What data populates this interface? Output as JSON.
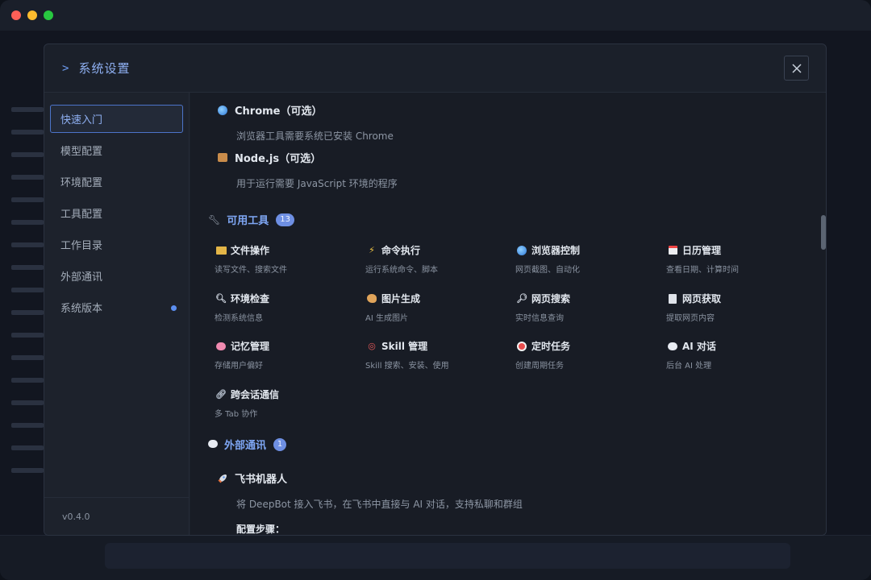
{
  "modal": {
    "title": "系统设置",
    "header_chevron": ">"
  },
  "sidebar": {
    "items": [
      {
        "label": "快速入门"
      },
      {
        "label": "模型配置"
      },
      {
        "label": "环境配置"
      },
      {
        "label": "工具配置"
      },
      {
        "label": "工作目录"
      },
      {
        "label": "外部通讯"
      },
      {
        "label": "系统版本"
      }
    ],
    "version": "v0.4.0"
  },
  "dependencies": [
    {
      "title": "Chrome（可选）",
      "desc": "浏览器工具需要系统已安装 Chrome",
      "icon": "globe-icon"
    },
    {
      "title": "Node.js（可选）",
      "desc": "用于运行需要 JavaScript 环境的程序",
      "icon": "package-icon"
    }
  ],
  "tools_section": {
    "title": "可用工具",
    "count": "13",
    "icon": "wrench-icon",
    "tools": [
      {
        "name": "文件操作",
        "desc": "读写文件、搜索文件",
        "icon": "folder-icon"
      },
      {
        "name": "命令执行",
        "desc": "运行系统命令、脚本",
        "icon": "lightning-icon"
      },
      {
        "name": "浏览器控制",
        "desc": "网页截图、自动化",
        "icon": "globe-icon"
      },
      {
        "name": "日历管理",
        "desc": "查看日期、计算时间",
        "icon": "calendar-icon"
      },
      {
        "name": "环境检查",
        "desc": "检测系统信息",
        "icon": "magnifier-icon"
      },
      {
        "name": "图片生成",
        "desc": "AI 生成图片",
        "icon": "palette-icon"
      },
      {
        "name": "网页搜索",
        "desc": "实时信息查询",
        "icon": "magnifier-right-icon"
      },
      {
        "name": "网页获取",
        "desc": "提取网页内容",
        "icon": "document-icon"
      },
      {
        "name": "记忆管理",
        "desc": "存储用户偏好",
        "icon": "brain-icon"
      },
      {
        "name": "Skill 管理",
        "desc": "Skill 搜索、安装、使用",
        "icon": "target-icon"
      },
      {
        "name": "定时任务",
        "desc": "创建周期任务",
        "icon": "alarm-clock-icon"
      },
      {
        "name": "AI 对话",
        "desc": "后台 AI 处理",
        "icon": "speech-bubble-icon"
      },
      {
        "name": "跨会话通信",
        "desc": "多 Tab 协作",
        "icon": "link-icon"
      }
    ]
  },
  "comms_section": {
    "title": "外部通讯",
    "count": "1",
    "icon": "speech-bubble-icon",
    "feishu": {
      "title": "飞书机器人",
      "desc": "将 DeepBot 接入飞书，在飞书中直接与 AI 对话，支持私聊和群组",
      "steps_label": "配置步骤："
    }
  },
  "colors": {
    "accent": "#7ea6f3",
    "badge": "#6e8fe3",
    "dot": "#5b8ef0"
  }
}
